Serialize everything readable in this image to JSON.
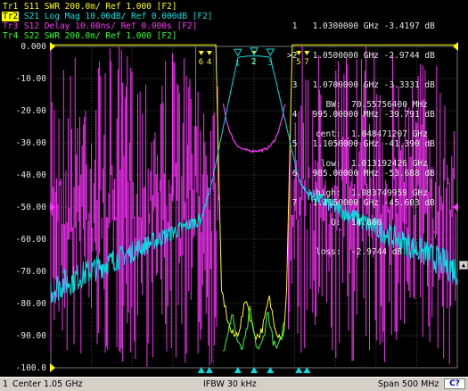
{
  "traces": [
    {
      "tag": "Tr1",
      "text": "S11 SWR 200.0m/ Ref 1.000 [F2]",
      "color": "#ffff00",
      "active": false
    },
    {
      "tag": "Tr2",
      "text": "S21 Log Mag 10.00dB/ Ref 0.000dB [F2]",
      "color": "#00e0e0",
      "active": true
    },
    {
      "tag": "Tr3",
      "text": "S12 Delay 10.00ns/ Ref 0.000s [F2]",
      "color": "#ff33ff",
      "active": false
    },
    {
      "tag": "Tr4",
      "text": "S22 SWR 200.0m/ Ref 1.000 [F2]",
      "color": "#33ff33",
      "active": false
    }
  ],
  "marker_list": [
    " 1   1.0300000 GHz -3.4197 dB",
    ">2   1.0500000 GHz -2.9744 dB",
    " 3   1.0700000 GHz -3.3331 dB",
    " 4   995.00000 MHz -39.791 dB",
    " 5   1.1050000 GHz -41.390 dB",
    " 6   985.00000 MHz -53.688 dB",
    " 7   1.1150000 GHz -45.603 dB"
  ],
  "bandwidth_stats": [
    "  BW:  70.55756400 MHz",
    "cent:  1.048471207 GHz",
    " low:  1.013192426 GHz",
    "high:  1.083749959 GHz",
    "   Q:  14.860",
    "loss:  -2.9744 dB"
  ],
  "y_axis_labels": [
    "0.000",
    "-10.00",
    "-20.00",
    "-30.00",
    "-40.00",
    "-50.00",
    "-60.00",
    "-70.00",
    "-80.00",
    "-90.00",
    "-100.0"
  ],
  "top_marker_labels": [
    "6",
    "4",
    "2",
    "5",
    "7"
  ],
  "trace_markers": [
    "1",
    "2",
    "3",
    "4",
    "5",
    "6",
    "7"
  ],
  "status_bar": {
    "channel": "1",
    "center": "Center 1.05 GHz",
    "ifbw": "IFBW 30 kHz",
    "span": "Span 500 MHz",
    "button": "C?"
  },
  "colors": {
    "grid": "#4a4a4a",
    "tr1": "#ffff00",
    "tr2": "#00e0e0",
    "tr3": "#ff33ff",
    "tr4": "#33ff33",
    "ref_marker": "#00e0e0"
  }
}
